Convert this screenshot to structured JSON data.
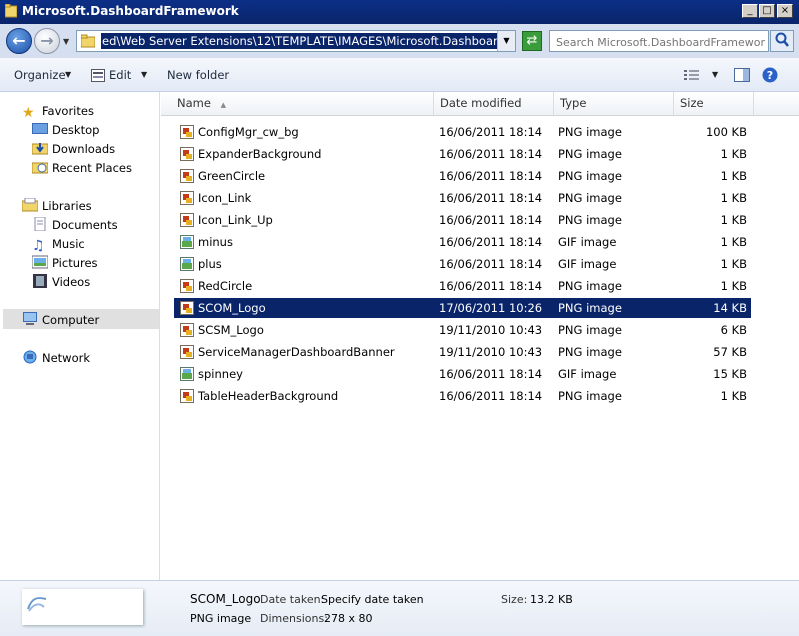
{
  "window": {
    "title": "Microsoft.DashboardFramework"
  },
  "window_controls": {
    "minimize": "_",
    "maximize": "□",
    "close": "×"
  },
  "address": {
    "path": "ed\\Web Server Extensions\\12\\TEMPLATE\\IMAGES\\Microsoft.DashboardFramework",
    "search_placeholder": "Search Microsoft.DashboardFramework"
  },
  "toolbar": {
    "organize": "Organize",
    "edit": "Edit",
    "new_folder": "New folder"
  },
  "nav": {
    "favorites": "Favorites",
    "favorites_items": [
      "Desktop",
      "Downloads",
      "Recent Places"
    ],
    "libraries": "Libraries",
    "libraries_items": [
      "Documents",
      "Music",
      "Pictures",
      "Videos"
    ],
    "computer": "Computer",
    "network": "Network"
  },
  "columns": {
    "name": "Name",
    "date": "Date modified",
    "type": "Type",
    "size": "Size"
  },
  "files": [
    {
      "name": "ConfigMgr_cw_bg",
      "date": "16/06/2011 18:14",
      "type": "PNG image",
      "size": "100 KB",
      "icon": "png-file-icon"
    },
    {
      "name": "ExpanderBackground",
      "date": "16/06/2011 18:14",
      "type": "PNG image",
      "size": "1 KB",
      "icon": "png-file-icon"
    },
    {
      "name": "GreenCircle",
      "date": "16/06/2011 18:14",
      "type": "PNG image",
      "size": "1 KB",
      "icon": "png-file-icon"
    },
    {
      "name": "Icon_Link",
      "date": "16/06/2011 18:14",
      "type": "PNG image",
      "size": "1 KB",
      "icon": "png-file-icon"
    },
    {
      "name": "Icon_Link_Up",
      "date": "16/06/2011 18:14",
      "type": "PNG image",
      "size": "1 KB",
      "icon": "png-file-icon"
    },
    {
      "name": "minus",
      "date": "16/06/2011 18:14",
      "type": "GIF image",
      "size": "1 KB",
      "icon": "gif-file-icon"
    },
    {
      "name": "plus",
      "date": "16/06/2011 18:14",
      "type": "GIF image",
      "size": "1 KB",
      "icon": "gif-file-icon"
    },
    {
      "name": "RedCircle",
      "date": "16/06/2011 18:14",
      "type": "PNG image",
      "size": "1 KB",
      "icon": "png-file-icon"
    },
    {
      "name": "SCOM_Logo",
      "date": "17/06/2011 10:26",
      "type": "PNG image",
      "size": "14 KB",
      "icon": "png-file-icon",
      "selected": true
    },
    {
      "name": "SCSM_Logo",
      "date": "19/11/2010 10:43",
      "type": "PNG image",
      "size": "6 KB",
      "icon": "png-file-icon"
    },
    {
      "name": "ServiceManagerDashboardBanner",
      "date": "19/11/2010 10:43",
      "type": "PNG image",
      "size": "57 KB",
      "icon": "png-file-icon"
    },
    {
      "name": "spinney",
      "date": "16/06/2011 18:14",
      "type": "GIF image",
      "size": "15 KB",
      "icon": "gif-file-icon"
    },
    {
      "name": "TableHeaderBackground",
      "date": "16/06/2011 18:14",
      "type": "PNG image",
      "size": "1 KB",
      "icon": "png-file-icon"
    }
  ],
  "details": {
    "name": "SCOM_Logo",
    "type": "PNG image",
    "date_taken_label": "Date taken:",
    "date_taken_value": "Specify date taken",
    "dimensions_label": "Dimensions:",
    "dimensions_value": "278 x 80",
    "size_label": "Size:",
    "size_value": "13.2 KB"
  },
  "colors": {
    "selection": "#0a246a",
    "titlebar": "#0a246a",
    "pane_bg": "#e6ecf5"
  }
}
